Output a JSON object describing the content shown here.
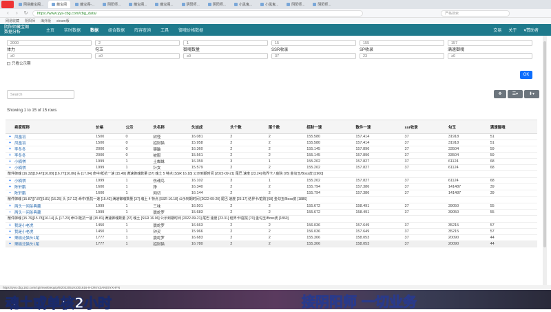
{
  "browser": {
    "tabs": [
      "网易藏宝阁...",
      "藏宝阁",
      "藏宝阁-...",
      "阴阳师...",
      "藏宝阁...",
      "藏宝阁...",
      "阴阳师...",
      "阴阳师...",
      "小黑鬼...",
      "小黑鬼...",
      "阴阳师...",
      "阴阳师..."
    ],
    "url": "https://www.yys-cbg.com/cbg_data/",
    "search_placeholder": "严格搜索",
    "bookmarks": [
      "网易收藏",
      "阴阳师",
      "海外版",
      "steam版"
    ]
  },
  "appnav": {
    "brand_top": "阴阳师藏宝阁",
    "brand_bottom": "数据分析",
    "items": [
      "主页",
      "实时数据",
      "数据",
      "组合数据",
      "阵容查询",
      "工具",
      "御魂价格数据"
    ],
    "right": [
      "交易",
      "关于",
      "♥赞助者"
    ]
  },
  "filters": {
    "row1": [
      "2000",
      "2",
      "1",
      "15",
      "155",
      "157"
    ],
    "labels2": [
      "体力",
      "勾玉",
      "御魂数量",
      "SSR收录",
      "SP收录",
      "满速御魂"
    ],
    "row2": [
      "≥0",
      "≥0",
      "≥0",
      "37",
      "23",
      "≥0"
    ],
    "checkbox": "只看公示期",
    "ok": "OK"
  },
  "search_placeholder": "Search",
  "rows_info": "Showing 1 to 15 of 15 rows",
  "table": {
    "headers": [
      "卖家昵称",
      "价格",
      "公示",
      "头名称",
      "头加成",
      "头个数",
      "尾个数",
      "招财一速",
      "散件一速",
      "ssr收录",
      "勾玉",
      "满速御魂"
    ],
    "rows": [
      {
        "exp": "+",
        "cells": [
          "凤凰羽",
          "1500",
          "0",
          "树怪",
          "16.081",
          "2",
          "2",
          "155.580",
          "157.414",
          "37",
          "31918",
          "51"
        ]
      },
      {
        "exp": "+",
        "cells": [
          "凤凰羽",
          "1500",
          "0",
          "招财猫",
          "15.958",
          "2",
          "2",
          "155.580",
          "157.414",
          "37",
          "31918",
          "51"
        ]
      },
      {
        "exp": "+",
        "cells": [
          "李冬冬",
          "2000",
          "0",
          "镰鼬",
          "16.360",
          "2",
          "2",
          "155.145",
          "157.896",
          "37",
          "33504",
          "59"
        ]
      },
      {
        "exp": "+",
        "cells": [
          "李冬冬",
          "2000",
          "0",
          "被服",
          "15.561",
          "2",
          "2",
          "155.145",
          "157.896",
          "37",
          "33504",
          "59"
        ]
      },
      {
        "exp": "+",
        "cells": [
          "小楠祺",
          "1999",
          "1",
          "土蜘蛛",
          "16.359",
          "3",
          "1",
          "155.202",
          "157.827",
          "37",
          "61124",
          "68"
        ]
      },
      {
        "exp": "−",
        "cells": [
          "小楠祺",
          "1999",
          "1",
          "针女",
          "15.579",
          "2",
          "2",
          "155.202",
          "157.827",
          "37",
          "61124",
          "68"
        ]
      },
      {
        "exp": "+",
        "cells": [
          "小楠祺",
          "1999",
          "1",
          "伤魂鸟",
          "16.102",
          "3",
          "1",
          "155.202",
          "157.827",
          "37",
          "61124",
          "68"
        ]
      },
      {
        "exp": "+",
        "cells": [
          "陈轩鹏",
          "1600",
          "1",
          "狰",
          "16.340",
          "2",
          "2",
          "155.794",
          "157.386",
          "37",
          "141487",
          "39"
        ]
      },
      {
        "exp": "−",
        "cells": [
          "陈轩鹏",
          "1600",
          "1",
          "网切",
          "16.144",
          "2",
          "2",
          "155.794",
          "157.386",
          "37",
          "141487",
          "39"
        ]
      },
      {
        "exp": "+",
        "cells": [
          "两头一闲杀典藏",
          "1999",
          "1",
          "三味",
          "16.501",
          "2",
          "2",
          "155.672",
          "158.491",
          "37",
          "39050",
          "55"
        ]
      },
      {
        "exp": "−",
        "cells": [
          "两头一闲杀典藏",
          "1999",
          "1",
          "胧蛇罗",
          "15.683",
          "2",
          "2",
          "155.672",
          "158.491",
          "37",
          "39050",
          "55"
        ]
      },
      {
        "exp": "+",
        "cells": [
          "我是小老虎",
          "1450",
          "1",
          "胧蛇罗",
          "16.663",
          "2",
          "2",
          "156.036",
          "157.649",
          "37",
          "35215",
          "57"
        ]
      },
      {
        "exp": "+",
        "cells": [
          "我是小老虎",
          "1450",
          "1",
          "钟灵",
          "15.966",
          "2",
          "2",
          "156.036",
          "157.649",
          "37",
          "35215",
          "57"
        ]
      },
      {
        "exp": "+",
        "cells": [
          "栗糕泛猫头1尾",
          "1777",
          "1",
          "胧蛇罗",
          "16.683",
          "2",
          "2",
          "155.306",
          "158.053",
          "37",
          "20090",
          "44"
        ]
      },
      {
        "exp": "+",
        "cells": [
          "栗糕泛猫头1尾",
          "1777",
          "1",
          "招财猫",
          "16.780",
          "2",
          "2",
          "155.306",
          "158.053",
          "37",
          "20090",
          "44"
        ]
      }
    ],
    "details": [
      "散件御魂 [16.32][19.47][16.89] [16.77][16.86] 头 [17.04] 命中/抵抗一速 [15.49] 满速御魂数量 [37] 魂土 5 特点 [SSR 16.18] 公示到期时间 [2022-09-21] 尾巴 速度 [23.24] 结界卡 / 庭院 [78] 金勾玉/Boss皮 [1960]",
      "散件御魂 [15.87][7.87][6.81] [16.25] 头 [17.12] 命中/抵抗一速 [15.42] 满速御魂数量 [37] 魂土 4 特点 [SSR 16.18] 公示到期时间 [2022-09-20] 尾巴 速度 [23.17] 结界卡/庭院 [68] 金勾玉/Boss皮 [1886]",
      "散件御魂 [15.76][15.78][16.14] 头 [17.20] 命中/抵抗一速 [15.81] 满速御魂数量 [37] 魂土 [SSR 16.06] 公示到期时间 [2022-09-21] 尾巴 速度 [23.31] 结界卡/庭院 [70] 金勾玉/Boss皮 [1860]"
    ]
  },
  "status_url": "https://yys.cbg.163.com/cgi/mweb/equip/9/202205191001616-9-CRKVZANE5YXHFN",
  "video_captions": [
    "魂土或单核2小时",
    "接阴阳师 一切业务"
  ]
}
